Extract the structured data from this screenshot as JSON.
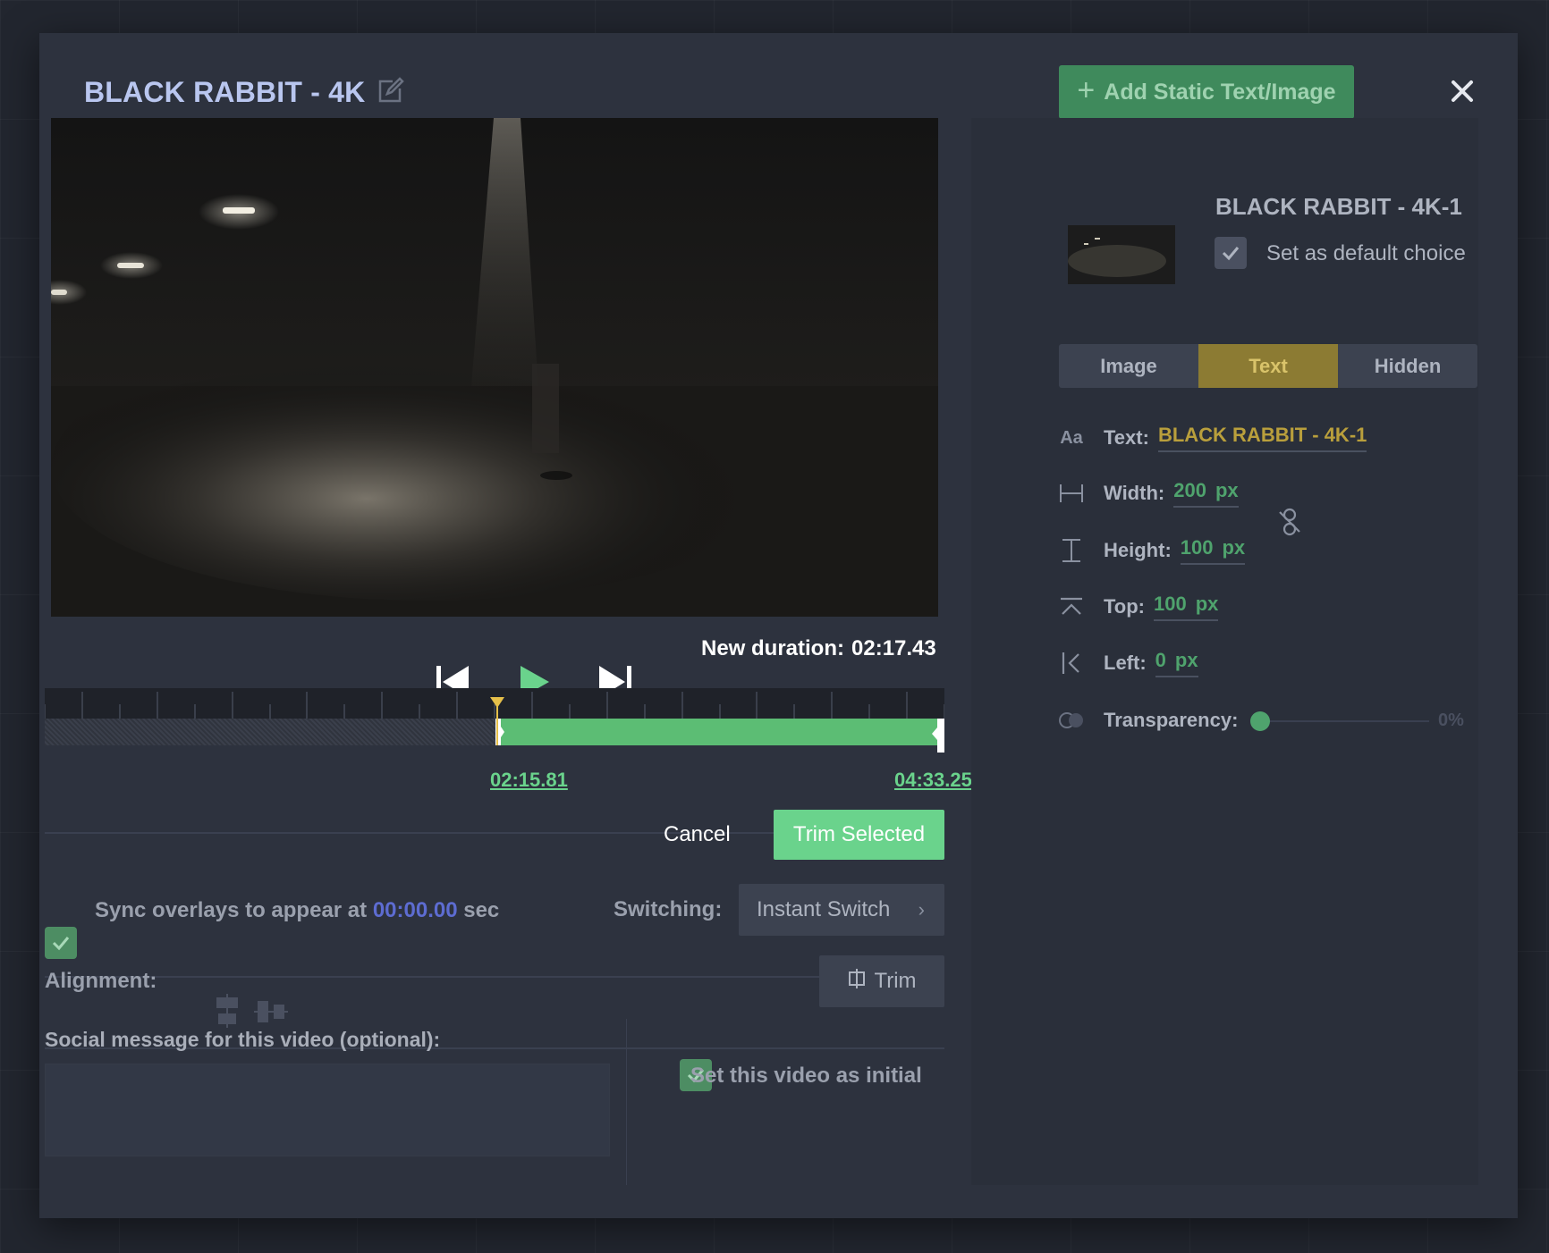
{
  "modal": {
    "title": "BLACK RABBIT - 4K",
    "add_button_label": "Add Static Text/Image"
  },
  "player": {
    "new_duration_label": "New duration:",
    "new_duration_value": "02:17.43"
  },
  "timeline": {
    "start_time": "02:15.81",
    "end_time": "04:33.25",
    "selection_start_fraction": 0.503,
    "selection_end_fraction": 1.0
  },
  "actions": {
    "cancel_label": "Cancel",
    "trim_selected_label": "Trim Selected"
  },
  "sync": {
    "checked": true,
    "prefix": "Sync overlays to appear at",
    "time": "00:00.00",
    "suffix": "sec"
  },
  "switching": {
    "label": "Switching:",
    "value": "Instant Switch"
  },
  "alignment": {
    "label": "Alignment:"
  },
  "trim_button_label": "Trim",
  "social": {
    "label": "Social message for this video (optional):",
    "value": ""
  },
  "initial": {
    "checked": true,
    "label": "Set this video as initial"
  },
  "option": {
    "title": "BLACK RABBIT - 4K-1",
    "default_label": "Set as default choice",
    "default_checked": true
  },
  "tabs": [
    {
      "label": "Image",
      "active": false
    },
    {
      "label": "Text",
      "active": true
    },
    {
      "label": "Hidden",
      "active": false
    }
  ],
  "properties": {
    "text_icon": "Aa",
    "text_label": "Text:",
    "text_value": "BLACK RABBIT - 4K-1",
    "width_label": "Width:",
    "width_value": "200",
    "height_label": "Height:",
    "height_value": "100",
    "top_label": "Top:",
    "top_value": "100",
    "left_label": "Left:",
    "left_value": "0",
    "unit": "px",
    "transparency_label": "Transparency:",
    "transparency_value": "0%"
  },
  "colors": {
    "accent_green": "#6ad38c",
    "active_tab": "#8c7b33",
    "title_blue": "#b9c6ef"
  }
}
